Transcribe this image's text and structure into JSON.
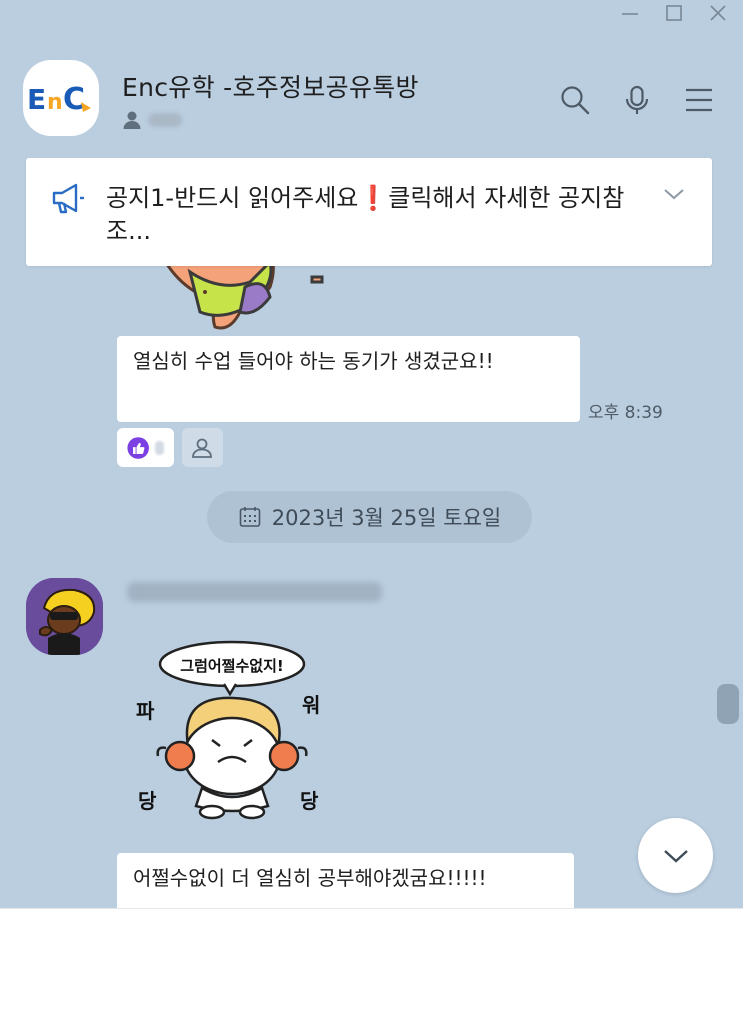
{
  "window": {
    "minimize_icon": "minimize-icon",
    "maximize_icon": "maximize-icon",
    "close_icon": "close-icon"
  },
  "header": {
    "title": "Enc유학 -호주정보공유톡방",
    "avatar_logo": "EnC",
    "icons": [
      "search-icon",
      "microphone-icon",
      "menu-icon"
    ]
  },
  "notice": {
    "text": "공지1-반드시 읽어주세요❗클릭해서 자세한 공지참조..."
  },
  "messages": [
    {
      "text": "열심히 수업 들어야 하는 동기가 생겼군요!!",
      "time": "오후 8:39"
    },
    {
      "text": "어쩔수없이 더 열심히 공부해야겠굼요!!!!!"
    }
  ],
  "date_divider": "2023년 3월 25일 토요일",
  "sticker": {
    "speech": "그럼어쩔수없지!",
    "sfx": [
      "파",
      "워",
      "당",
      "당"
    ]
  },
  "colors": {
    "chat_bg": "#bacee0",
    "like_purple": "#7b3fe4",
    "brand_blue": "#1a5bb8",
    "brand_orange": "#f5a623"
  }
}
